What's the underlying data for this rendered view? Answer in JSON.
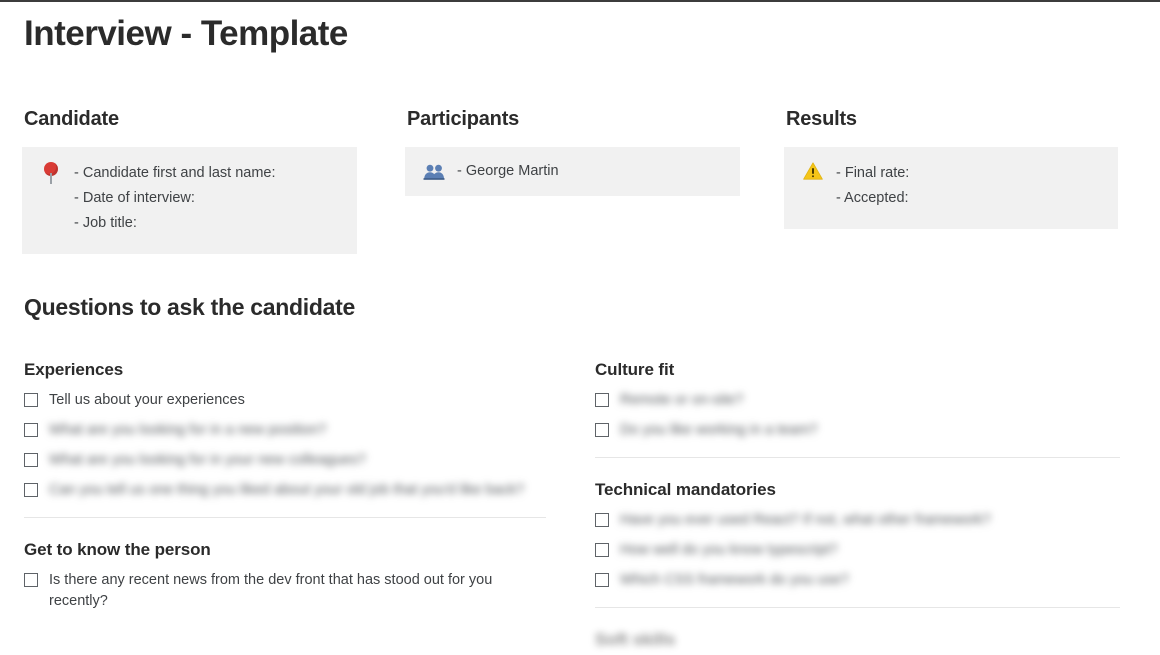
{
  "page_title": "Interview - Template",
  "cards": [
    {
      "heading": "Candidate",
      "icon": "map-pin-icon",
      "lines": [
        "- Candidate first and last name:",
        "- Date of interview:",
        "- Job title:"
      ]
    },
    {
      "heading": "Participants",
      "icon": "people-icon",
      "lines": [
        "- George Martin"
      ]
    },
    {
      "heading": "Results",
      "icon": "warning-icon",
      "lines": [
        "- Final rate:",
        "- Accepted:"
      ]
    }
  ],
  "questions": {
    "title": "Questions to ask the candidate",
    "left_sections": [
      {
        "heading": "Experiences",
        "items": [
          {
            "text": "Tell us about your experiences",
            "blurred": false,
            "checked": false
          },
          {
            "text": "What are you looking for in a new position?",
            "blurred": true,
            "checked": false
          },
          {
            "text": "What are you looking for in your new colleagues?",
            "blurred": true,
            "checked": false
          },
          {
            "text": "Can you tell us one thing you liked about your old job that you'd like back?",
            "blurred": true,
            "checked": false
          }
        ]
      },
      {
        "heading": "Get to know the person",
        "items": [
          {
            "text": "Is there any recent news from the dev front that has stood out for you recently?",
            "blurred": false,
            "checked": false
          }
        ]
      }
    ],
    "right_sections": [
      {
        "heading": "Culture fit",
        "items": [
          {
            "text": "Remote or on-site?",
            "blurred": true,
            "checked": false
          },
          {
            "text": "Do you like working in a team?",
            "blurred": true,
            "checked": false
          }
        ]
      },
      {
        "heading": "Technical mandatories",
        "items": [
          {
            "text": "Have you ever used React? If not, what other framework?",
            "blurred": true,
            "checked": false
          },
          {
            "text": "How well do you know typescript?",
            "blurred": true,
            "checked": false
          },
          {
            "text": "Which CSS framework do you use?",
            "blurred": true,
            "checked": false
          }
        ]
      }
    ],
    "clipped_heading": "Soft skills"
  },
  "colors": {
    "card_background": "#f1f1f1",
    "pin_red": "#d93b35",
    "warning_yellow": "#f5c518",
    "people_blue": "#5b7fb4",
    "text": "#3f4245",
    "heading": "#2b2b2b",
    "divider": "#e6e6e6"
  }
}
